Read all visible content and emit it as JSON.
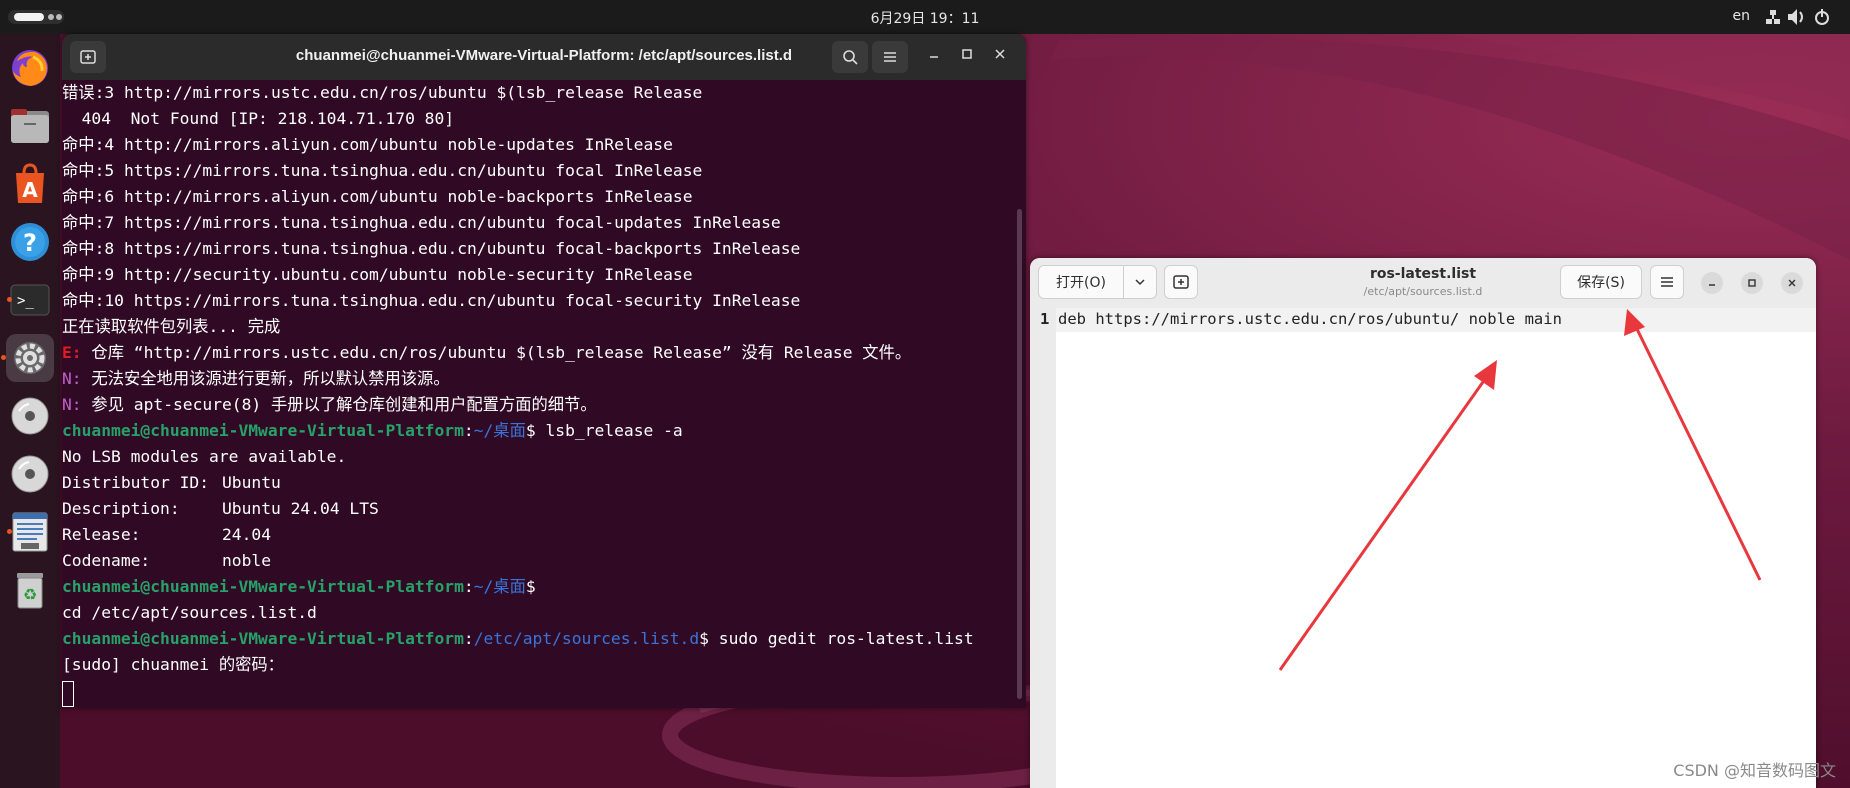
{
  "topbar": {
    "clock": "6月29日  19：11",
    "lang": "en"
  },
  "dock": {
    "items": [
      {
        "name": "firefox",
        "icon": "firefox-icon"
      },
      {
        "name": "files",
        "icon": "folder-icon"
      },
      {
        "name": "app-center",
        "icon": "app-center-icon"
      },
      {
        "name": "help",
        "icon": "help-icon",
        "glyph": "?"
      },
      {
        "name": "terminal",
        "icon": "terminal-icon",
        "glyph": ">_"
      },
      {
        "name": "settings",
        "icon": "gear-icon"
      },
      {
        "name": "disc-1",
        "icon": "disc-icon"
      },
      {
        "name": "disc-2",
        "icon": "disc-icon"
      },
      {
        "name": "text-editor",
        "icon": "text-editor-icon"
      },
      {
        "name": "trash",
        "icon": "trash-icon",
        "glyph": "♻"
      }
    ]
  },
  "terminal": {
    "title": "chuanmei@chuanmei-VMware-Virtual-Platform: /etc/apt/sources.list.d",
    "lines": [
      {
        "a": "错误:3 http://mirrors.ustc.edu.cn/ros/ubuntu $(lsb_release Release"
      },
      {
        "a": "  404  Not Found [IP: 218.104.71.170 80]"
      },
      {
        "a": "命中:4 http://mirrors.aliyun.com/ubuntu noble-updates InRelease"
      },
      {
        "a": "命中:5 https://mirrors.tuna.tsinghua.edu.cn/ubuntu focal InRelease"
      },
      {
        "a": "命中:6 http://mirrors.aliyun.com/ubuntu noble-backports InRelease"
      },
      {
        "a": "命中:7 https://mirrors.tuna.tsinghua.edu.cn/ubuntu focal-updates InRelease"
      },
      {
        "a": "命中:8 https://mirrors.tuna.tsinghua.edu.cn/ubuntu focal-backports InRelease"
      },
      {
        "a": "命中:9 http://security.ubuntu.com/ubuntu noble-security InRelease"
      },
      {
        "a": "命中:10 https://mirrors.tuna.tsinghua.edu.cn/ubuntu focal-security InRelease"
      },
      {
        "a": "正在读取软件包列表... 完成"
      },
      {
        "p": "E: ",
        "a": "仓库 “http://mirrors.ustc.edu.cn/ros/ubuntu $(lsb_release Release” 没有 Release 文件。"
      },
      {
        "p": "N: ",
        "a": "无法安全地用该源进行更新，所以默认禁用该源。"
      },
      {
        "p": "N: ",
        "a": "参见 apt-secure(8) 手册以了解仓库创建和用户配置方面的细节。"
      },
      {
        "user": "chuanmei@chuanmei-VMware-Virtual-Platform",
        "sep": ":",
        "path": "~/桌面",
        "cmd": "$ lsb_release -a"
      },
      {
        "a": "No LSB modules are available."
      },
      {
        "a": "Distributor ID:\tUbuntu"
      },
      {
        "a": "Description:\tUbuntu 24.04 LTS"
      },
      {
        "a": "Release:\t24.04"
      },
      {
        "a": "Codename:\tnoble"
      },
      {
        "user": "chuanmei@chuanmei-VMware-Virtual-Platform",
        "sep": ":",
        "path": "~/桌面",
        "cmd": "$"
      },
      {
        "a": "cd /etc/apt/sources.list.d"
      },
      {
        "user": "chuanmei@chuanmei-VMware-Virtual-Platform",
        "sep": ":",
        "path": "/etc/apt/sources.list.d",
        "cmd": "$ sudo gedit ros-latest.list"
      },
      {
        "a": "[sudo] chuanmei 的密码："
      }
    ]
  },
  "gedit": {
    "open_label": "打开(O)",
    "save_label": "保存(S)",
    "title": "ros-latest.list",
    "subtitle": "/etc/apt/sources.list.d",
    "line_number": "1",
    "line_text": "deb https://mirrors.ustc.edu.cn/ros/ubuntu/ noble main"
  },
  "colors": {
    "arrow": "#e8383d",
    "ubuntu_orange": "#e95420"
  },
  "watermark": "CSDN @知音数码图文"
}
